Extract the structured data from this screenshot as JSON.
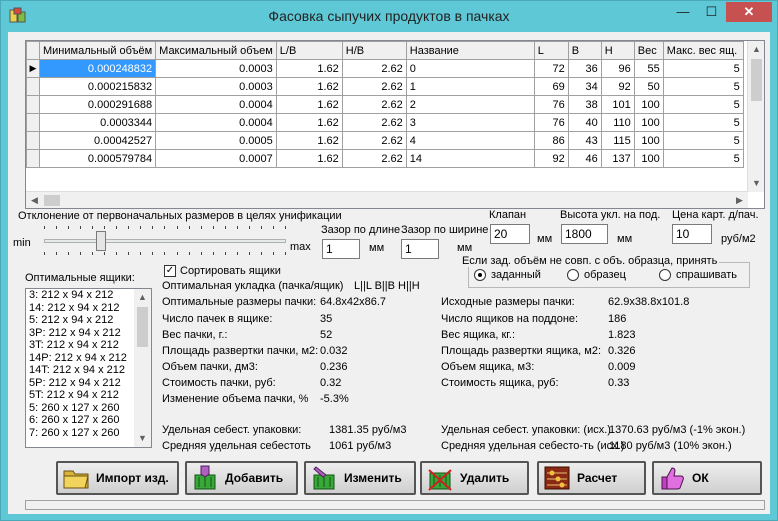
{
  "window": {
    "title": "Фасовка сыпучих продуктов в пачках",
    "min_glyph": "—",
    "max_glyph": "☐",
    "close_glyph": "✕"
  },
  "grid": {
    "columns": [
      "Минимальный объём",
      "Максимальный объем",
      "L/B",
      "H/B",
      "Название",
      "L",
      "B",
      "H",
      "Вес",
      "Макс. вес ящ."
    ],
    "rows": [
      [
        "0.000248832",
        "0.0003",
        "1.62",
        "2.62",
        "0",
        "72",
        "36",
        "96",
        "55",
        "5"
      ],
      [
        "0.000215832",
        "0.0003",
        "1.62",
        "2.62",
        "1",
        "69",
        "34",
        "92",
        "50",
        "5"
      ],
      [
        "0.000291688",
        "0.0004",
        "1.62",
        "2.62",
        "2",
        "76",
        "38",
        "101",
        "100",
        "5"
      ],
      [
        "0.0003344",
        "0.0004",
        "1.62",
        "2.62",
        "3",
        "76",
        "40",
        "110",
        "100",
        "5"
      ],
      [
        "0.00042527",
        "0.0005",
        "1.62",
        "2.62",
        "4",
        "86",
        "43",
        "115",
        "100",
        "5"
      ],
      [
        "0.000579784",
        "0.0007",
        "1.62",
        "2.62",
        "14",
        "92",
        "46",
        "137",
        "100",
        "5"
      ]
    ],
    "current_row_marker": "▶"
  },
  "unification": {
    "label": "Отклонение от первоначальных размеров в целях унификации",
    "min": "min",
    "max": "max"
  },
  "gap_length": {
    "label": "Зазор по длине",
    "value": "1",
    "unit": "мм"
  },
  "gap_width": {
    "label": "Зазор по ширине",
    "value": "1",
    "unit": "мм"
  },
  "valve": {
    "label": "Клапан",
    "value": "20",
    "unit": "мм"
  },
  "stack_height": {
    "label": "Высота укл. на под.",
    "value": "1800",
    "unit": "мм"
  },
  "cardboard_price": {
    "label": "Цена карт. д/пач.",
    "value": "10",
    "unit": "руб/м2"
  },
  "boxes": {
    "label": "Оптимальные ящики:",
    "items": [
      "3: 212 x 94 x 212",
      "14: 212 x 94 x 212",
      "5: 212 x 94 x 212",
      "3P: 212 x 94 x 212",
      "3T: 212 x 94 x 212",
      "14P: 212 x 94 x 212",
      "14T: 212 x 94 x 212",
      "5P: 212 x 94 x 212",
      "5T: 212 x 94 x 212",
      "5: 260 x 127 x 260",
      "6: 260 x 127 x 260",
      "7: 260 x 127 x 260"
    ]
  },
  "sort_boxes": {
    "label": "Сортировать ящики",
    "checked": true,
    "check_glyph": "✓"
  },
  "volume_mismatch": {
    "label": "Если зад. объём не совп. с объ. образца, принять",
    "options": [
      "заданный",
      "образец",
      "спрашивать"
    ],
    "selected": 0
  },
  "results_left": [
    {
      "label": "Оптимальная укладка (пачка/ящик)",
      "value": "L||L B||B H||H"
    },
    {
      "label": "Оптимальные размеры пачки:",
      "value": "64.8x42x86.7"
    },
    {
      "label": "Число пачек в ящике:",
      "value": "35"
    },
    {
      "label": "Вес пачки, г.:",
      "value": "52"
    },
    {
      "label": "Площадь развертки пачки, м2:",
      "value": "0.032"
    },
    {
      "label": "Объем пачки, дм3:",
      "value": "0.236"
    },
    {
      "label": "Стоимость пачки, руб:",
      "value": "0.32"
    },
    {
      "label": "Изменение объема пачки, %",
      "value": "-5.3%"
    }
  ],
  "results_right": [
    {
      "label": "Исходные размеры пачки:",
      "value": "62.9x38.8x101.8"
    },
    {
      "label": "Число ящиков на поддоне:",
      "value": "186"
    },
    {
      "label": "Вес ящика, кг.:",
      "value": "1.823"
    },
    {
      "label": "Площадь развертки ящика, м2:",
      "value": "0.326"
    },
    {
      "label": "Объем ящика, м3:",
      "value": "0.009"
    },
    {
      "label": "Стоимость ящика, руб:",
      "value": "0.33"
    }
  ],
  "cost_left": [
    {
      "label": "Удельная себест. упаковки:",
      "value": "1381.35 руб/м3"
    },
    {
      "label": "Средняя удельная себестоть",
      "value": "1061 руб/м3"
    }
  ],
  "cost_right": [
    {
      "label": "Удельная себест. упаковки: (исх.)",
      "value": "1370.63 руб/м3 (-1% экон.)"
    },
    {
      "label": "Средняя удельная себесто-ть (исх.)",
      "value": "1180 руб/м3 (10% экон.)"
    }
  ],
  "buttons": {
    "import": "Импорт изд.",
    "add": "Добавить",
    "edit": "Изменить",
    "delete": "Удалить",
    "calculate": "Расчет",
    "ok": "ОК"
  }
}
